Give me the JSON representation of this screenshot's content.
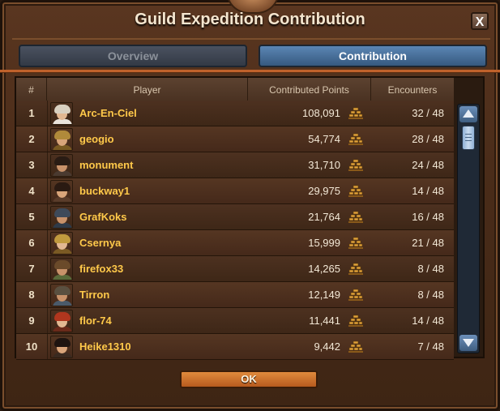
{
  "window": {
    "title": "Guild Expedition Contribution",
    "close_label": "X"
  },
  "tabs": [
    {
      "label": "Overview",
      "active": false
    },
    {
      "label": "Contribution",
      "active": true
    }
  ],
  "table": {
    "headers": {
      "rank": "#",
      "player": "Player",
      "points": "Contributed Points",
      "encounters": "Encounters"
    },
    "rows": [
      {
        "rank": "1",
        "player": "Arc-En-Ciel",
        "points": "108,091",
        "encounters": "32 / 48",
        "avatar": {
          "skin": "#e2b892",
          "hair": "#d8d0c0",
          "body": "#e9e4dc"
        }
      },
      {
        "rank": "2",
        "player": "geogio",
        "points": "54,774",
        "encounters": "28 / 48",
        "avatar": {
          "skin": "#d9a57a",
          "hair": "#b08a3a",
          "body": "#7a5a22"
        }
      },
      {
        "rank": "3",
        "player": "monument",
        "points": "31,710",
        "encounters": "24 / 48",
        "avatar": {
          "skin": "#c8926a",
          "hair": "#2a1c14",
          "body": "#4a3a30"
        }
      },
      {
        "rank": "4",
        "player": "buckway1",
        "points": "29,975",
        "encounters": "14 / 48",
        "avatar": {
          "skin": "#d9a57a",
          "hair": "#2a1a12",
          "body": "#5a3c2a"
        }
      },
      {
        "rank": "5",
        "player": "GrafKoks",
        "points": "21,764",
        "encounters": "16 / 48",
        "avatar": {
          "skin": "#c8926a",
          "hair": "#3e4a5a",
          "body": "#2e3a48"
        }
      },
      {
        "rank": "6",
        "player": "Csernya",
        "points": "15,999",
        "encounters": "21 / 48",
        "avatar": {
          "skin": "#e2b892",
          "hair": "#c09a3e",
          "body": "#7a5a24"
        }
      },
      {
        "rank": "7",
        "player": "firefox33",
        "points": "14,265",
        "encounters": "8 / 48",
        "avatar": {
          "skin": "#c8926a",
          "hair": "#6a4a2a",
          "body": "#5a6a3a"
        }
      },
      {
        "rank": "8",
        "player": "Tirron",
        "points": "12,149",
        "encounters": "8 / 48",
        "avatar": {
          "skin": "#c8926a",
          "hair": "#5a5040",
          "body": "#4a5a6a"
        }
      },
      {
        "rank": "9",
        "player": "flor-74",
        "points": "11,441",
        "encounters": "14 / 48",
        "avatar": {
          "skin": "#e2b892",
          "hair": "#b0361e",
          "body": "#6a2a1a"
        }
      },
      {
        "rank": "10",
        "player": "Heike1310",
        "points": "9,442",
        "encounters": "7 / 48",
        "avatar": {
          "skin": "#d9a57a",
          "hair": "#1e1410",
          "body": "#3a2a20"
        }
      }
    ]
  },
  "footer": {
    "ok_label": "OK"
  },
  "colors": {
    "player_name": "#ffc94a",
    "active_tab": "#4a74a0",
    "ok_button": "#d07a34",
    "accent_line": "#c0622b",
    "resource_icon": "#e0a23a"
  },
  "icons": {
    "resource": "expedition-points-icon"
  }
}
